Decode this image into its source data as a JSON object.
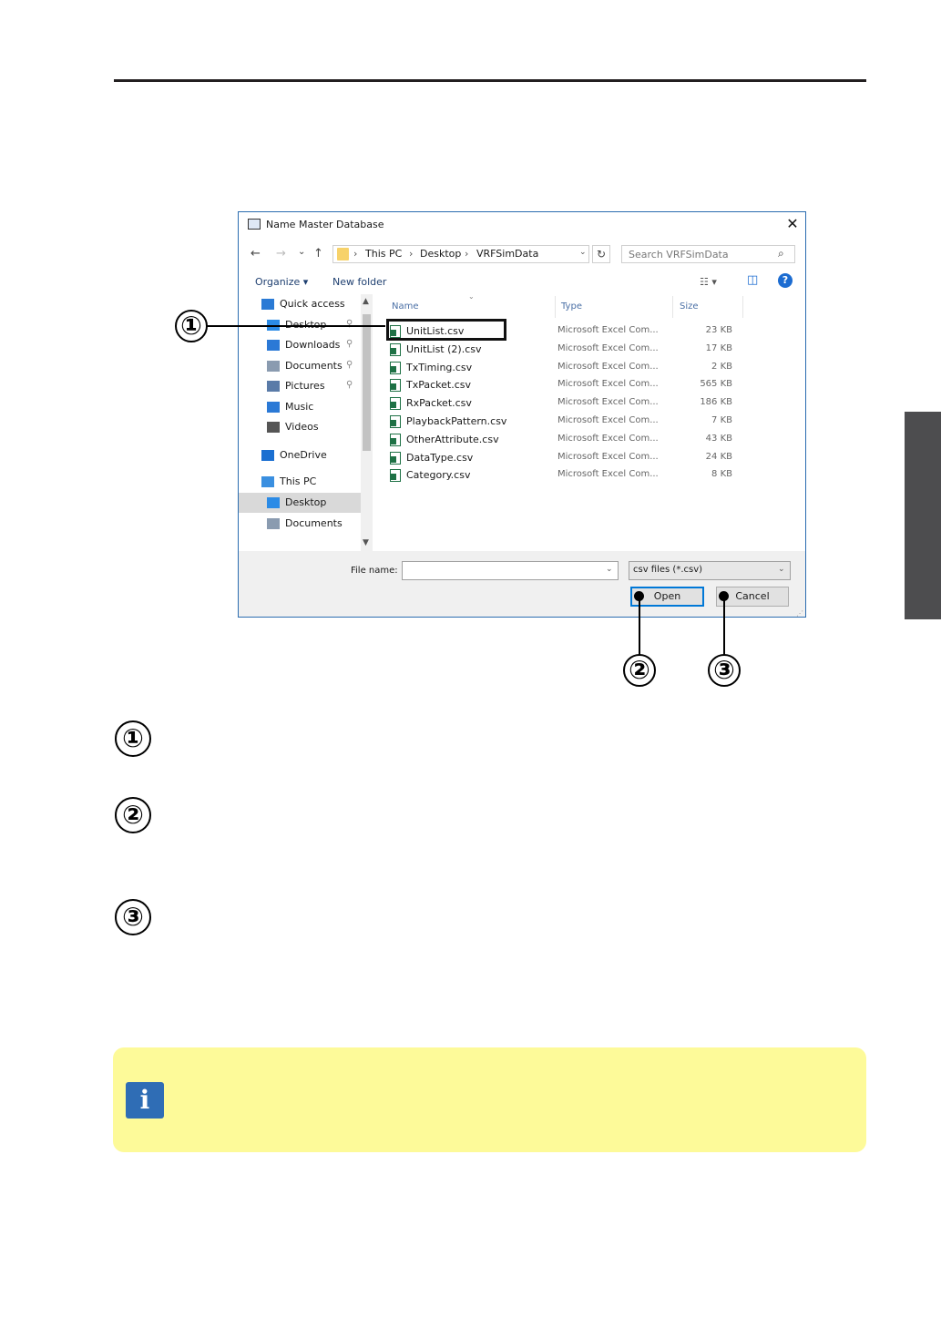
{
  "dialog": {
    "title": "Name Master Database",
    "close_label": "✕",
    "nav": {
      "back": "←",
      "forward": "→",
      "recent": "⌄",
      "up": "↑"
    },
    "address": {
      "crumbs": [
        "This PC",
        "Desktop",
        "VRFSimData"
      ],
      "separator": "›",
      "dropdown": "⌄"
    },
    "refresh": "↻",
    "search_placeholder": "Search VRFSimData",
    "toolbar": {
      "organize": "Organize ▾",
      "new_folder": "New folder",
      "view": "☷ ▾",
      "pane": "◫",
      "help": "?"
    },
    "sidebar": [
      {
        "label": "Quick access",
        "icon": "star-icon",
        "color": "#2a7ad5",
        "pinned": false,
        "indent": false
      },
      {
        "label": "Desktop",
        "icon": "desktop-icon",
        "color": "#2b8be6",
        "pinned": true,
        "indent": true
      },
      {
        "label": "Downloads",
        "icon": "download-icon",
        "color": "#2b79d6",
        "pinned": true,
        "indent": true
      },
      {
        "label": "Documents",
        "icon": "document-icon",
        "color": "#8a9bb0",
        "pinned": true,
        "indent": true
      },
      {
        "label": "Pictures",
        "icon": "pictures-icon",
        "color": "#5a7ba8",
        "pinned": true,
        "indent": true
      },
      {
        "label": "Music",
        "icon": "music-icon",
        "color": "#2b79d6",
        "pinned": false,
        "indent": true
      },
      {
        "label": "Videos",
        "icon": "videos-icon",
        "color": "#555555",
        "pinned": false,
        "indent": true
      },
      {
        "label": "OneDrive",
        "icon": "onedrive-icon",
        "color": "#1a6fd1",
        "pinned": false,
        "indent": false
      },
      {
        "label": "This PC",
        "icon": "this-pc-icon",
        "color": "#3a8fe0",
        "pinned": false,
        "indent": false
      },
      {
        "label": "Desktop",
        "icon": "desktop-icon",
        "color": "#2b8be6",
        "pinned": false,
        "indent": true,
        "selected": true
      },
      {
        "label": "Documents",
        "icon": "document-icon",
        "color": "#8a9bb0",
        "pinned": false,
        "indent": true
      }
    ],
    "columns": {
      "name": "Name",
      "type": "Type",
      "size": "Size"
    },
    "files": [
      {
        "name": "UnitList.csv",
        "type": "Microsoft Excel Com...",
        "size": "23 KB"
      },
      {
        "name": "UnitList (2).csv",
        "type": "Microsoft Excel Com...",
        "size": "17 KB"
      },
      {
        "name": "TxTiming.csv",
        "type": "Microsoft Excel Com...",
        "size": "2 KB"
      },
      {
        "name": "TxPacket.csv",
        "type": "Microsoft Excel Com...",
        "size": "565 KB"
      },
      {
        "name": "RxPacket.csv",
        "type": "Microsoft Excel Com...",
        "size": "186 KB"
      },
      {
        "name": "PlaybackPattern.csv",
        "type": "Microsoft Excel Com...",
        "size": "7 KB"
      },
      {
        "name": "OtherAttribute.csv",
        "type": "Microsoft Excel Com...",
        "size": "43 KB"
      },
      {
        "name": "DataType.csv",
        "type": "Microsoft Excel Com...",
        "size": "24 KB"
      },
      {
        "name": "Category.csv",
        "type": "Microsoft Excel Com...",
        "size": "8 KB"
      }
    ],
    "file_name_label": "File name:",
    "file_name_value": "",
    "file_type": "csv files (*.csv)",
    "open_label": "Open",
    "cancel_label": "Cancel"
  },
  "callouts": [
    "①",
    "②",
    "③"
  ],
  "steps": [
    "①",
    "②",
    "③"
  ],
  "note_icon": "i"
}
